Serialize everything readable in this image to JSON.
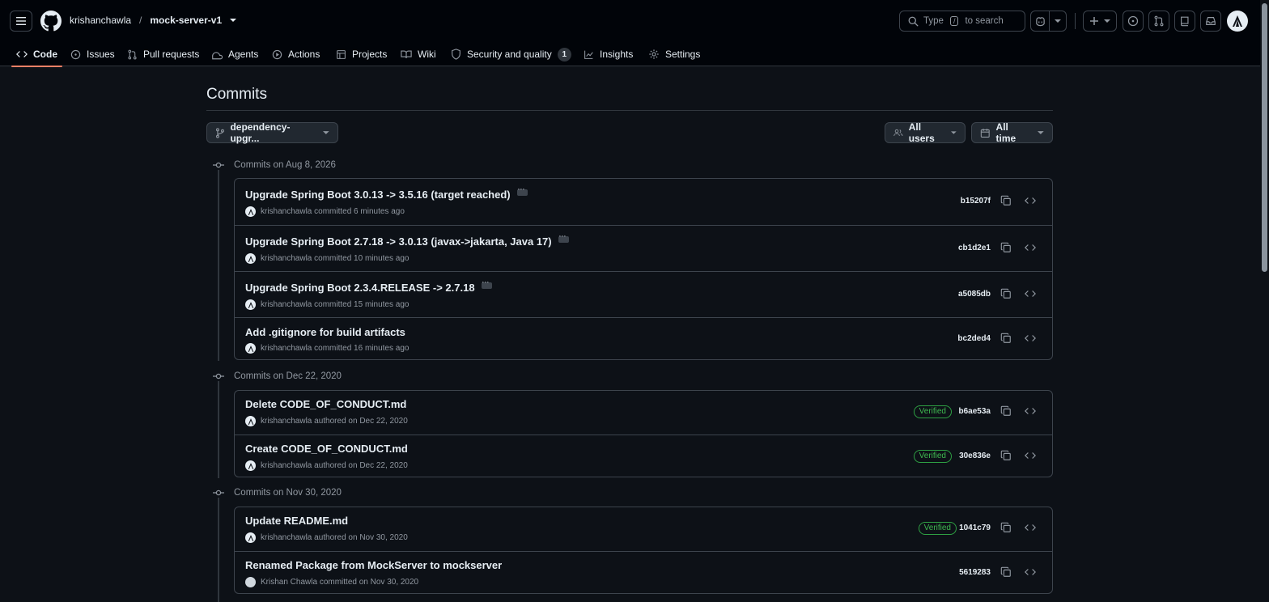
{
  "header": {
    "owner": "krishanchawla",
    "separator": "/",
    "repo": "mock-server-v1",
    "search": {
      "prefix": "Type",
      "key": "/",
      "suffix": "to search"
    }
  },
  "tabs": [
    {
      "label": "Code",
      "icon": "code-icon",
      "active": true
    },
    {
      "label": "Issues",
      "icon": "issue-icon"
    },
    {
      "label": "Pull requests",
      "icon": "pull-request-icon"
    },
    {
      "label": "Agents",
      "icon": "agent-icon"
    },
    {
      "label": "Actions",
      "icon": "play-icon"
    },
    {
      "label": "Projects",
      "icon": "table-icon"
    },
    {
      "label": "Wiki",
      "icon": "book-icon"
    },
    {
      "label": "Security and quality",
      "icon": "shield-icon",
      "count": "1"
    },
    {
      "label": "Insights",
      "icon": "graph-icon"
    },
    {
      "label": "Settings",
      "icon": "gear-icon"
    }
  ],
  "page": {
    "title": "Commits",
    "branch": "dependency-upgr...",
    "users_filter": "All users",
    "time_filter": "All time"
  },
  "groups": [
    {
      "heading": "Commits on Aug 8, 2026",
      "commits": [
        {
          "title": "Upgrade Spring Boot 3.0.13 -> 3.5.16 (target reached)",
          "author": "krishanchawla",
          "meta": "committed 6 minutes ago",
          "sha": "b15207f",
          "ellipsis": true
        },
        {
          "title": "Upgrade Spring Boot 2.7.18 -> 3.0.13 (javax->jakarta, Java 17)",
          "author": "krishanchawla",
          "meta": "committed 10 minutes ago",
          "sha": "cb1d2e1",
          "ellipsis": true
        },
        {
          "title": "Upgrade Spring Boot 2.3.4.RELEASE -> 2.7.18",
          "author": "krishanchawla",
          "meta": "committed 15 minutes ago",
          "sha": "a5085db",
          "ellipsis": true
        },
        {
          "title": "Add .gitignore for build artifacts",
          "author": "krishanchawla",
          "meta": "committed 16 minutes ago",
          "sha": "bc2ded4"
        }
      ]
    },
    {
      "heading": "Commits on Dec 22, 2020",
      "commits": [
        {
          "title": "Delete CODE_OF_CONDUCT.md",
          "author": "krishanchawla",
          "meta": "authored on Dec 22, 2020",
          "sha": "b6ae53a",
          "verified": "Verified"
        },
        {
          "title": "Create CODE_OF_CONDUCT.md",
          "author": "krishanchawla",
          "meta": "authored on Dec 22, 2020",
          "sha": "30e836e",
          "verified": "Verified"
        }
      ]
    },
    {
      "heading": "Commits on Nov 30, 2020",
      "commits": [
        {
          "title": "Update README.md",
          "author": "krishanchawla",
          "meta": "authored on Nov 30, 2020",
          "sha": "1041c79",
          "verified": "Verified"
        },
        {
          "title": "Renamed Package from MockServer to mockserver",
          "author": "Krishan Chawla",
          "meta": "committed on Nov 30, 2020",
          "sha": "5619283"
        }
      ]
    }
  ],
  "colors": {
    "background": "#0d1117",
    "header": "#010409",
    "border": "#3d444d",
    "accent_tab": "#f78166",
    "verified": "#3fb950"
  }
}
